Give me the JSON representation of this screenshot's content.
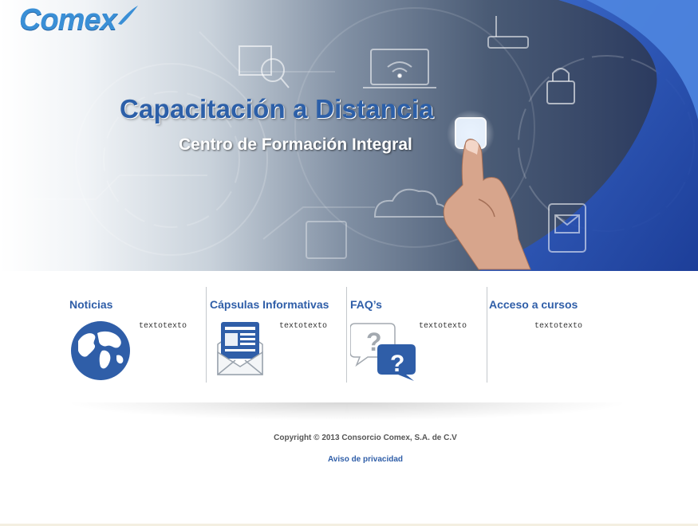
{
  "brand": {
    "logo_text": "Comex",
    "accent": "#3a8fd6",
    "link_color": "#2f5ea8"
  },
  "hero": {
    "title": "Capacitación a Distancia",
    "subtitle": "Centro de Formación Integral",
    "background_icons": [
      "binary-search-icon",
      "laptop-wifi-icon",
      "router-icon",
      "padlock-icon",
      "cloud-icon",
      "battery-icon",
      "mail-tablet-icon",
      "pointing-hand-icon"
    ]
  },
  "sections": [
    {
      "title": "Noticias",
      "text": "textotexto",
      "icon": "globe-icon"
    },
    {
      "title": "Cápsulas Informativas",
      "text": "textotexto",
      "icon": "newsletter-envelope-icon"
    },
    {
      "title": "FAQ’s",
      "text": "textotexto",
      "icon": "question-bubbles-icon"
    },
    {
      "title": "Acceso a cursos",
      "text": "textotexto",
      "icon": ""
    }
  ],
  "footer": {
    "copyright": "Copyright © 2013 Consorcio Comex, S.A. de C.V",
    "privacy_link": "Aviso de privacidad"
  }
}
